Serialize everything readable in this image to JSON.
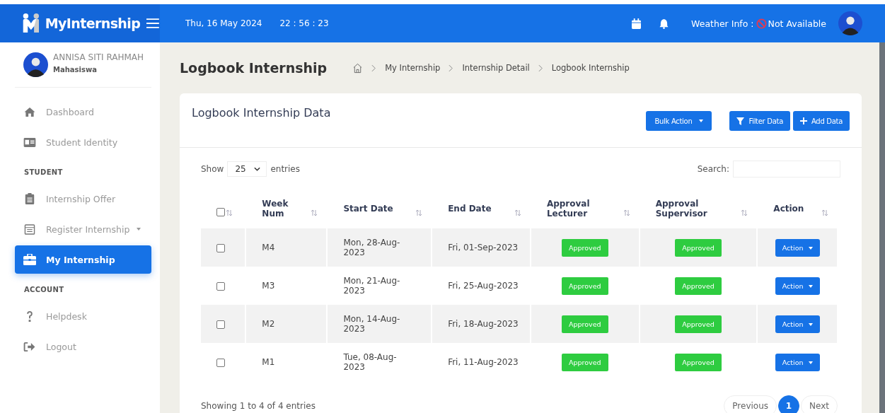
{
  "header": {
    "brand": "MyInternship",
    "date": "Thu, 16 May 2024",
    "time": "22 : 56 : 23",
    "weather_label": "Weather Info :",
    "weather_value": "Not Available"
  },
  "profile": {
    "name": "ANNISA SITI RAHMAH",
    "role": "Mahasiswa"
  },
  "sidebar": {
    "items": [
      {
        "kind": "link",
        "label": "Dashboard",
        "selected": false
      },
      {
        "kind": "link",
        "label": "Student Identity",
        "selected": false
      },
      {
        "kind": "section",
        "label": "STUDENT"
      },
      {
        "kind": "link",
        "label": "Internship Offer",
        "selected": false
      },
      {
        "kind": "dropdown",
        "label": "Register Internship",
        "selected": false
      },
      {
        "kind": "link",
        "label": "My Internship",
        "selected": true
      },
      {
        "kind": "section",
        "label": "ACCOUNT"
      },
      {
        "kind": "link",
        "label": "Helpdesk",
        "selected": false
      },
      {
        "kind": "link",
        "label": "Logout",
        "selected": false
      }
    ]
  },
  "page": {
    "title": "Logbook Internship",
    "breadcrumb": [
      "My Internship",
      "Internship Detail",
      "Logbook Internship"
    ]
  },
  "card": {
    "title": "Logbook Internship Data",
    "buttons": [
      {
        "kind": "dropdown",
        "label": "Bulk Action"
      },
      {
        "kind": "filter",
        "label": "Filter Data"
      },
      {
        "kind": "add",
        "label": "Add Data"
      }
    ],
    "show_label": "Show",
    "page_size": "25",
    "entries_label": "entries",
    "search_label": "Search:",
    "columns": [
      "Week Num",
      "Start Date",
      "End Date",
      "Approval Lecturer",
      "Approval Supervisor",
      "Action"
    ],
    "select_all_checked": false,
    "rows": [
      {
        "checked": false,
        "week": "M4",
        "start": "Mon, 28-Aug-2023",
        "end": "Fri, 01-Sep-2023",
        "lecturer": "Approved",
        "supervisor": "Approved",
        "action": "Action"
      },
      {
        "checked": false,
        "week": "M3",
        "start": "Mon, 21-Aug-2023",
        "end": "Fri, 25-Aug-2023",
        "lecturer": "Approved",
        "supervisor": "Approved",
        "action": "Action"
      },
      {
        "checked": false,
        "week": "M2",
        "start": "Mon, 14-Aug-2023",
        "end": "Fri, 18-Aug-2023",
        "lecturer": "Approved",
        "supervisor": "Approved",
        "action": "Action"
      },
      {
        "checked": false,
        "week": "M1",
        "start": "Tue, 08-Aug-2023",
        "end": "Fri, 11-Aug-2023",
        "lecturer": "Approved",
        "supervisor": "Approved",
        "action": "Action"
      }
    ],
    "info": "Showing 1 to 4 of 4 entries",
    "pagination": [
      {
        "label": "Previous",
        "selected": false
      },
      {
        "label": "1",
        "selected": true
      },
      {
        "label": "Next",
        "selected": false
      }
    ]
  }
}
